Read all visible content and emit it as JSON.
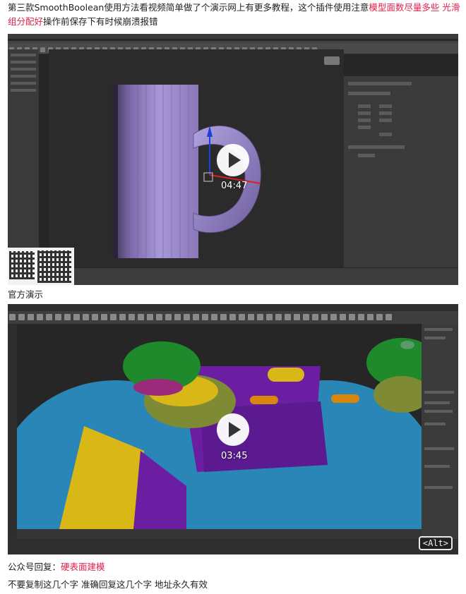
{
  "intro": {
    "text_normal": "第三款SmoothBoolean使用方法看视频简单做了个演示网上有更多教程，这个插件使用注意",
    "text_red": "模型面数尽量多些 光滑组分配好",
    "text_after": "操作前保存下有时候崩溃报错"
  },
  "video1": {
    "duration": "04:47"
  },
  "caption2": "官方演示",
  "video2": {
    "duration": "03:45",
    "alt_badge": "<Alt>"
  },
  "reply": {
    "label": "公众号回复：",
    "keyword": "硬表面建模"
  },
  "note": "不要复制这几个字 准确回复这几个字 地址永久有效",
  "colors": {
    "accent_red": "#e0224d",
    "mug_purple": "#9b86cc",
    "controller_blue": "#2a86b7",
    "controller_green": "#1f8a2c",
    "controller_yellow": "#d8b716",
    "controller_purple": "#6c1ea3",
    "controller_orange": "#d9860d",
    "controller_olive": "#7f8a35"
  },
  "icons": [
    "play-icon"
  ]
}
